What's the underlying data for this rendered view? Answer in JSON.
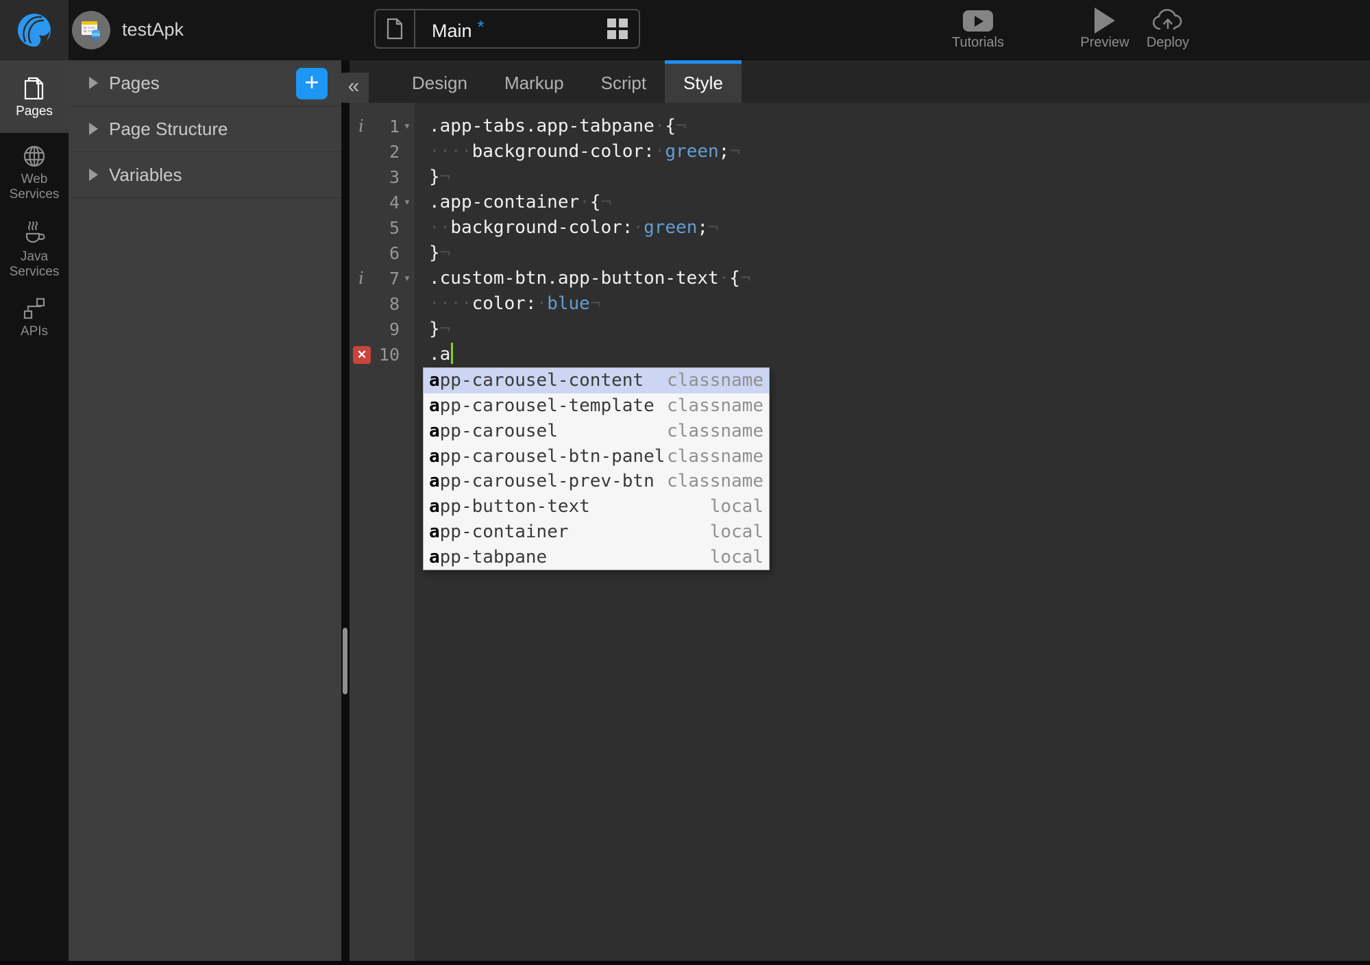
{
  "glyphs": {
    "collapse_panel": "«",
    "add": "+",
    "fold": "▾",
    "eol": "¬",
    "error": "✕",
    "info": "i"
  },
  "colors": {
    "accent": "#1e96f3",
    "code_value_blue": "#639ed3",
    "caret_green": "#7ed321",
    "error_red": "#c9443a",
    "hint_selected": "#ccd5f1"
  },
  "topbar": {
    "app_name": "testApk",
    "page_tab": {
      "name": "Main",
      "dirty": "*"
    },
    "actions": {
      "tutorials": "Tutorials",
      "preview": "Preview",
      "deploy": "Deploy"
    }
  },
  "sidebar": {
    "items": [
      {
        "id": "pages",
        "label_top": "Pages",
        "label_bottom": "",
        "active": true
      },
      {
        "id": "web-services",
        "label_top": "Web",
        "label_bottom": "Services",
        "active": false
      },
      {
        "id": "java-services",
        "label_top": "Java",
        "label_bottom": "Services",
        "active": false
      },
      {
        "id": "apis",
        "label_top": "APIs",
        "label_bottom": "",
        "active": false
      }
    ]
  },
  "panel": {
    "sections": [
      {
        "label": "Pages",
        "has_add_button": true
      },
      {
        "label": "Page Structure",
        "has_add_button": false
      },
      {
        "label": "Variables",
        "has_add_button": false
      }
    ]
  },
  "editor": {
    "tabs": [
      {
        "label": "Design",
        "active": false
      },
      {
        "label": "Markup",
        "active": false
      },
      {
        "label": "Script",
        "active": false
      },
      {
        "label": "Style",
        "active": true
      }
    ],
    "lines": [
      {
        "num": "1",
        "info": true,
        "fold": true,
        "error": false,
        "cursor": false,
        "tokens": [
          [
            "p",
            ".app-tabs.app-tabpane"
          ],
          [
            "w",
            "·"
          ],
          [
            "p",
            "{"
          ],
          [
            "e",
            "¬"
          ]
        ]
      },
      {
        "num": "2",
        "info": false,
        "fold": false,
        "error": false,
        "cursor": false,
        "tokens": [
          [
            "w",
            "····"
          ],
          [
            "p",
            "background-color:"
          ],
          [
            "w",
            "·"
          ],
          [
            "v",
            "green"
          ],
          [
            "p",
            ";"
          ],
          [
            "e",
            "¬"
          ]
        ]
      },
      {
        "num": "3",
        "info": false,
        "fold": false,
        "error": false,
        "cursor": false,
        "tokens": [
          [
            "p",
            "}"
          ],
          [
            "e",
            "¬"
          ]
        ]
      },
      {
        "num": "4",
        "info": false,
        "fold": true,
        "error": false,
        "cursor": false,
        "tokens": [
          [
            "p",
            ".app-container"
          ],
          [
            "w",
            "·"
          ],
          [
            "p",
            "{"
          ],
          [
            "e",
            "¬"
          ]
        ]
      },
      {
        "num": "5",
        "info": false,
        "fold": false,
        "error": false,
        "cursor": false,
        "tokens": [
          [
            "w",
            "··"
          ],
          [
            "p",
            "background-color:"
          ],
          [
            "w",
            "·"
          ],
          [
            "v",
            "green"
          ],
          [
            "p",
            ";"
          ],
          [
            "e",
            "¬"
          ]
        ]
      },
      {
        "num": "6",
        "info": false,
        "fold": false,
        "error": false,
        "cursor": false,
        "tokens": [
          [
            "p",
            "}"
          ],
          [
            "e",
            "¬"
          ]
        ]
      },
      {
        "num": "7",
        "info": true,
        "fold": true,
        "error": false,
        "cursor": false,
        "tokens": [
          [
            "p",
            ".custom-btn.app-button-text"
          ],
          [
            "w",
            "·"
          ],
          [
            "p",
            "{"
          ],
          [
            "e",
            "¬"
          ]
        ]
      },
      {
        "num": "8",
        "info": false,
        "fold": false,
        "error": false,
        "cursor": false,
        "tokens": [
          [
            "w",
            "····"
          ],
          [
            "p",
            "color:"
          ],
          [
            "w",
            "·"
          ],
          [
            "v",
            "blue"
          ],
          [
            "e",
            "¬"
          ]
        ]
      },
      {
        "num": "9",
        "info": false,
        "fold": false,
        "error": false,
        "cursor": false,
        "tokens": [
          [
            "p",
            "}"
          ],
          [
            "e",
            "¬"
          ]
        ]
      },
      {
        "num": "10",
        "info": false,
        "fold": false,
        "error": true,
        "cursor": true,
        "tokens": [
          [
            "p",
            ".a"
          ]
        ]
      }
    ],
    "autocomplete": [
      {
        "bold": "a",
        "rest": "pp-carousel-content",
        "meta": "classname",
        "selected": true
      },
      {
        "bold": "a",
        "rest": "pp-carousel-template",
        "meta": "classname",
        "selected": false
      },
      {
        "bold": "a",
        "rest": "pp-carousel",
        "meta": "classname",
        "selected": false
      },
      {
        "bold": "a",
        "rest": "pp-carousel-btn-panel",
        "meta": "classname",
        "selected": false
      },
      {
        "bold": "a",
        "rest": "pp-carousel-prev-btn",
        "meta": "classname",
        "selected": false
      },
      {
        "bold": "a",
        "rest": "pp-button-text",
        "meta": "local",
        "selected": false
      },
      {
        "bold": "a",
        "rest": "pp-container",
        "meta": "local",
        "selected": false
      },
      {
        "bold": "a",
        "rest": "pp-tabpane",
        "meta": "local",
        "selected": false
      }
    ]
  }
}
